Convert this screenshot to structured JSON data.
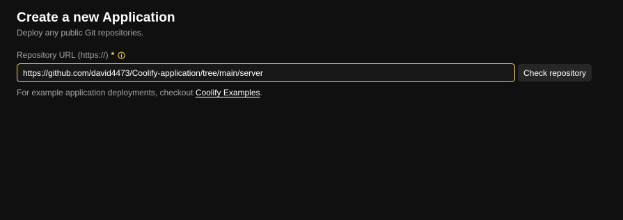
{
  "header": {
    "title": "Create a new Application",
    "subtitle": "Deploy any public Git repositories."
  },
  "repository_field": {
    "label": "Repository URL (https://)",
    "required_marker": "*",
    "info_icon": "info-circle-icon",
    "value": "https://github.com/david4473/Coolify-application/tree/main/server",
    "focused": true
  },
  "check_button": {
    "label": "Check repository"
  },
  "helper": {
    "text": "For example application deployments, checkout ",
    "link_text": "Coolify Examples",
    "trailing": "."
  },
  "colors": {
    "background": "#101010",
    "accent": "#fcd34d",
    "muted_text": "#a3a3a3",
    "button_bg": "#262626"
  }
}
